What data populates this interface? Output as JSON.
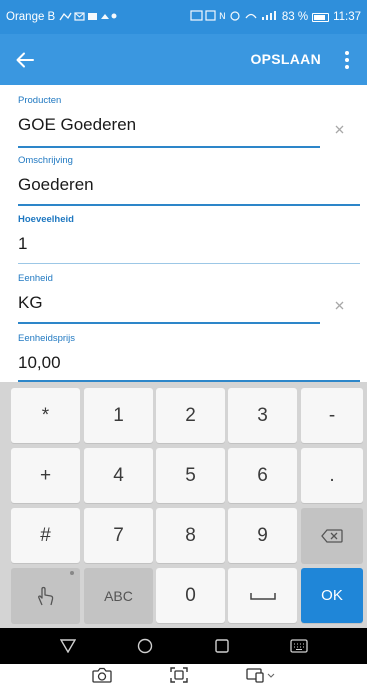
{
  "status_bar": {
    "carrier": "Orange B",
    "battery": "83 %",
    "time": "11:37"
  },
  "app_bar": {
    "back_icon": "arrow-left-icon",
    "save_label": "OPSLAAN",
    "more_icon": "more-vertical-icon"
  },
  "form": {
    "fields": [
      {
        "label": "Producten",
        "value": "GOE Goederen",
        "clearable": true
      },
      {
        "label": "Omschrijving",
        "value": "Goederen",
        "clearable": false
      },
      {
        "label": "Hoeveelheid",
        "value": "1",
        "clearable": false,
        "focused": true
      },
      {
        "label": "Eenheid",
        "value": "KG",
        "clearable": true
      },
      {
        "label": "Eenheidsprijs",
        "value": "10,00",
        "clearable": false
      }
    ]
  },
  "keypad": {
    "keys": [
      "*",
      "1",
      "2",
      "3",
      "-",
      "+",
      "4",
      "5",
      "6",
      ".",
      "#",
      "7",
      "8",
      "9",
      "ABC",
      "0",
      "OK"
    ],
    "icons": [
      "backspace-icon",
      "hand-gesture-icon",
      "space-icon"
    ]
  },
  "colors": {
    "status_bar": "#2f8fdb",
    "app_bar": "#3a97e0",
    "label": "#1f78c1",
    "ok_key": "#1f86d8"
  }
}
